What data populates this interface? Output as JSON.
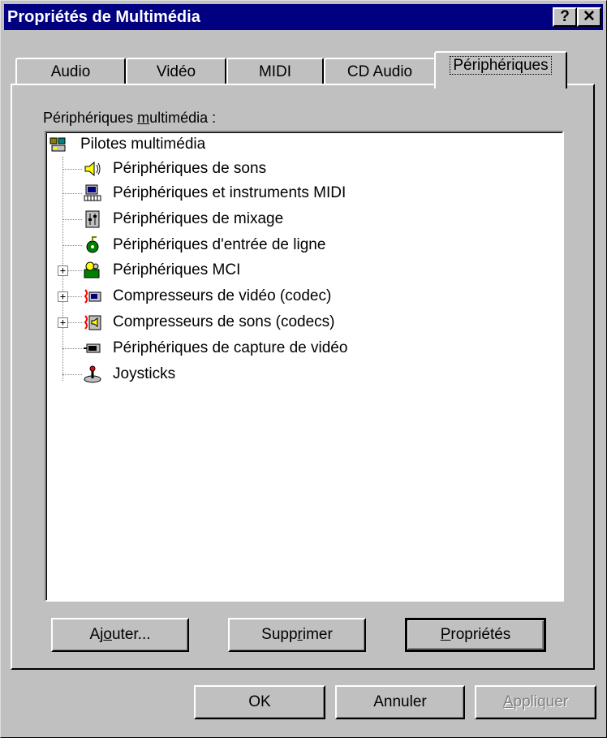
{
  "window": {
    "title": "Propriétés de Multimédia",
    "help_button": "?",
    "close_button": "✕"
  },
  "tabs": [
    {
      "label": "Audio",
      "active": false
    },
    {
      "label": "Vidéo",
      "active": false
    },
    {
      "label": "MIDI",
      "active": false
    },
    {
      "label": "CD Audio",
      "active": false
    },
    {
      "label": "Périphériques",
      "active": true
    }
  ],
  "panel": {
    "label_pre": "Périphériques ",
    "label_access": "m",
    "label_post": "ultimédia :"
  },
  "tree": {
    "root": {
      "label": "Pilotes multimédia",
      "icon": "multimedia-drivers-icon"
    },
    "children": [
      {
        "label": "Périphériques de sons",
        "icon": "speaker-icon",
        "expandable": false
      },
      {
        "label": "Périphériques et instruments MIDI",
        "icon": "midi-computer-icon",
        "expandable": false
      },
      {
        "label": "Périphériques de mixage",
        "icon": "mixer-icon",
        "expandable": false
      },
      {
        "label": "Périphériques d'entrée de ligne",
        "icon": "line-input-icon",
        "expandable": false
      },
      {
        "label": "Périphériques MCI",
        "icon": "mci-icon",
        "expandable": true
      },
      {
        "label": "Compresseurs de vidéo (codec)",
        "icon": "video-codec-icon",
        "expandable": true
      },
      {
        "label": "Compresseurs de sons (codecs)",
        "icon": "audio-codec-icon",
        "expandable": true
      },
      {
        "label": "Périphériques de capture de vidéo",
        "icon": "video-capture-icon",
        "expandable": false
      },
      {
        "label": "Joysticks",
        "icon": "joystick-icon",
        "expandable": false
      }
    ]
  },
  "panel_buttons": {
    "add_pre": "Aj",
    "add_access": "o",
    "add_post": "uter...",
    "remove_pre": "Supp",
    "remove_access": "r",
    "remove_post": "imer",
    "props_access": "P",
    "props_post": "ropriétés"
  },
  "dialog_buttons": {
    "ok": "OK",
    "cancel": "Annuler",
    "apply_access": "A",
    "apply_post": "ppliquer"
  }
}
